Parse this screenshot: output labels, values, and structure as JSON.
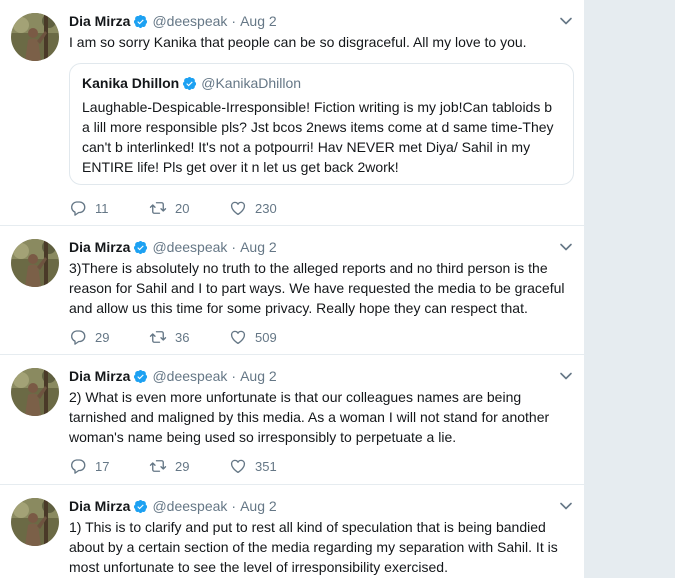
{
  "tweets": [
    {
      "name": "Dia Mirza",
      "handle": "@deespeak",
      "separator": "·",
      "time": "Aug 2",
      "lines": [
        "I am so sorry Kanika that people can be so disgraceful. All my love to you."
      ],
      "quote": {
        "name": "Kanika Dhillon",
        "handle": "@KanikaDhillon",
        "lines": [
          "Laughable-Despicable-Irresponsible! Fiction writing is my job!Can tabloids b",
          "a lill more responsible pls? Jst bcos 2news items come at d same time-They",
          "can't b interlinked! It's not a potpourri! Hav NEVER met Diya/ Sahil in my",
          "ENTIRE life! Pls get over it n let us get back 2work!"
        ]
      },
      "replies": "11",
      "retweets": "20",
      "likes": "230"
    },
    {
      "name": "Dia Mirza",
      "handle": "@deespeak",
      "separator": "·",
      "time": "Aug 2",
      "lines": [
        "3)There is absolutely no truth to the alleged reports and no third person is the",
        "reason for Sahil and I to part ways. We have requested the media to be graceful",
        "and allow us this time for some privacy. Really hope they can respect that."
      ],
      "replies": "29",
      "retweets": "36",
      "likes": "509"
    },
    {
      "name": "Dia Mirza",
      "handle": "@deespeak",
      "separator": "·",
      "time": "Aug 2",
      "lines": [
        "2) What is even more unfortunate is that our colleagues names are being",
        "tarnished and maligned by this media. As a woman I will not stand for another",
        "woman's name being used so irresponsibly to perpetuate a lie."
      ],
      "replies": "17",
      "retweets": "29",
      "likes": "351"
    },
    {
      "name": "Dia Mirza",
      "handle": "@deespeak",
      "separator": "·",
      "time": "Aug 2",
      "lines": [
        "1) This is to clarify and put to rest all kind of speculation that is being bandied",
        "about by a certain section of the media regarding my separation with Sahil. It is",
        "most unfortunate to see the level of irresponsibility exercised."
      ]
    }
  ],
  "colors": {
    "text": "#14171a",
    "secondary": "#657786",
    "verified": "#1da1f2",
    "border": "#e6ecf0",
    "background": "#e6ecf0"
  },
  "icons": {
    "verified": "verified-badge-icon",
    "caret": "chevron-down-icon",
    "reply": "reply-icon",
    "retweet": "retweet-icon",
    "like": "heart-icon"
  }
}
